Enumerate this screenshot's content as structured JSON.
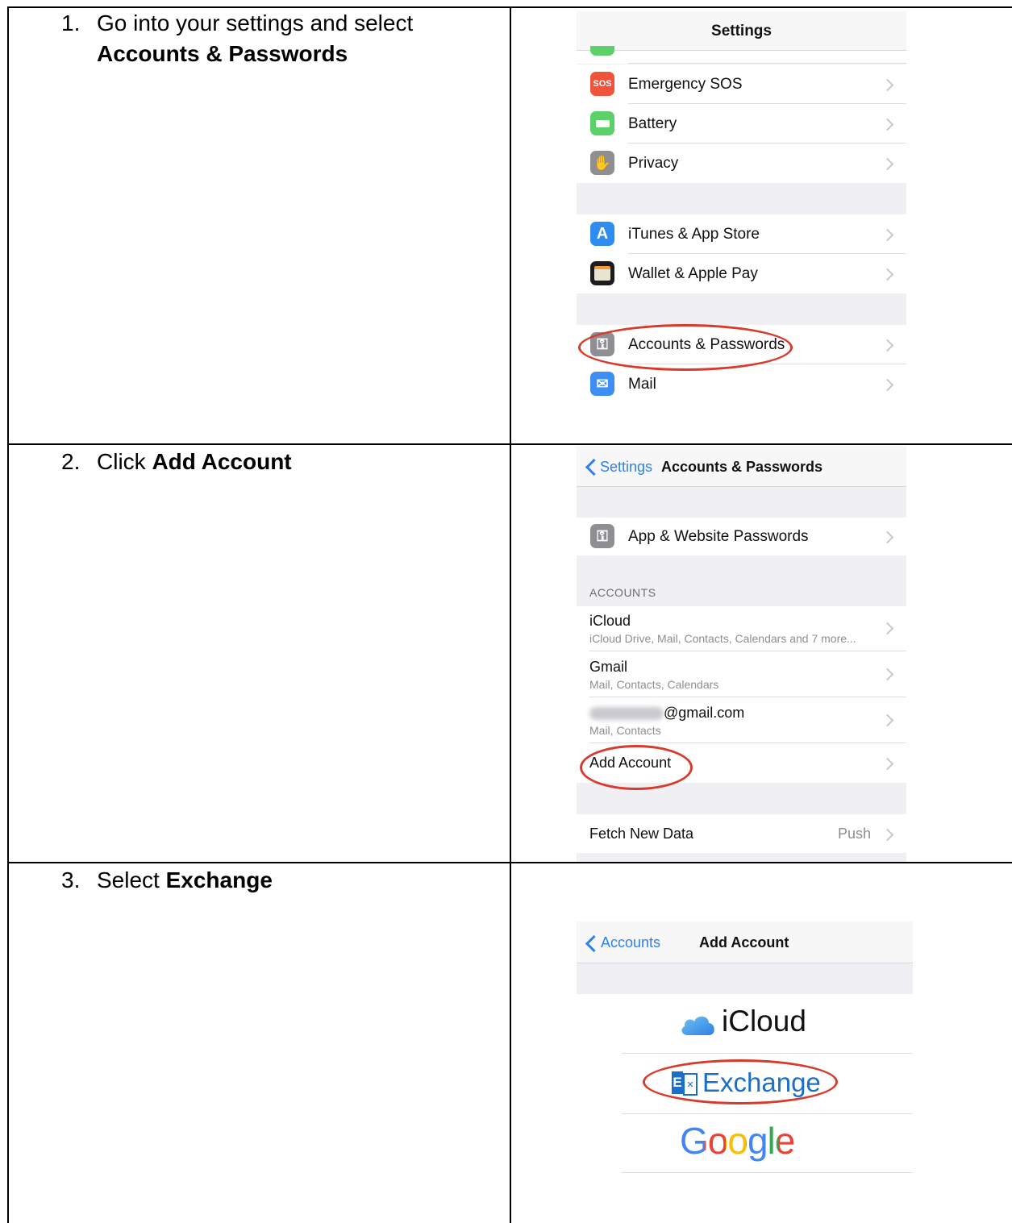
{
  "steps": [
    {
      "number": "1.",
      "text": "Go into your settings and select",
      "bold": "Accounts & Passwords"
    },
    {
      "number": "2.",
      "text": "Click ",
      "bold": "Add Account"
    },
    {
      "number": "3.",
      "text": "Select ",
      "bold": "Exchange"
    }
  ],
  "screen1": {
    "title": "Settings",
    "rows": [
      {
        "label": "Emergency SOS",
        "icon": "sos-icon",
        "icon_text": "SOS",
        "color": "#f0533a"
      },
      {
        "label": "Battery",
        "icon": "battery-icon",
        "color": "#5cd16a"
      },
      {
        "label": "Privacy",
        "icon": "hand-icon",
        "color": "#8e8e93"
      },
      {
        "label": "iTunes & App Store",
        "icon": "app-store-icon",
        "color": "#2f8cf0"
      },
      {
        "label": "Wallet & Apple Pay",
        "icon": "wallet-icon",
        "color": "#1c1c1e"
      },
      {
        "label": "Accounts & Passwords",
        "icon": "key-icon",
        "color": "#8e8e93"
      },
      {
        "label": "Mail",
        "icon": "mail-icon",
        "color": "#3d8ff5"
      }
    ]
  },
  "screen2": {
    "back_label": "Settings",
    "title": "Accounts & Passwords",
    "passwords_row": "App & Website Passwords",
    "section_header": "ACCOUNTS",
    "accounts": [
      {
        "name": "iCloud",
        "detail": "iCloud Drive, Mail, Contacts, Calendars and 7 more..."
      },
      {
        "name": "Gmail",
        "detail": "Mail, Contacts, Calendars"
      },
      {
        "name": "@gmail.com",
        "detail": "Mail, Contacts"
      }
    ],
    "add_account": "Add Account",
    "fetch_label": "Fetch New Data",
    "fetch_value": "Push"
  },
  "screen3": {
    "back_label": "Accounts",
    "title": "Add Account",
    "providers": {
      "icloud": "iCloud",
      "exchange": "Exchange",
      "google": "Google"
    }
  },
  "colors": {
    "highlight_oval": "#d83a2b",
    "ios_blue": "#2f80ed"
  }
}
